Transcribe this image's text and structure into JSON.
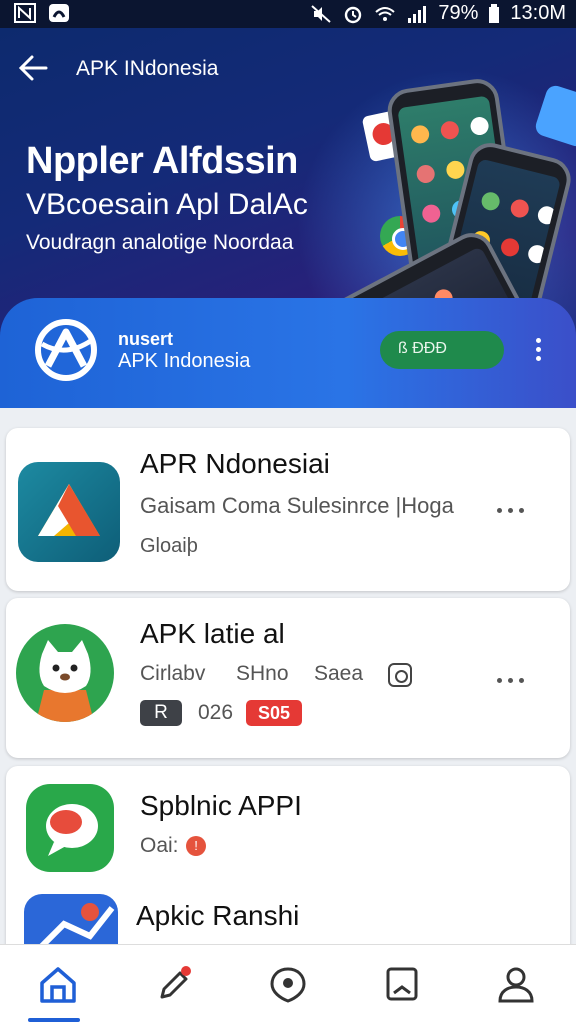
{
  "status_bar": {
    "battery": "79%",
    "time": "13:0M",
    "icons": [
      "n-logo-icon",
      "square-app-icon",
      "mute-icon",
      "alarm-icon",
      "wifi-icon",
      "signal-icon",
      "battery-icon"
    ]
  },
  "app_bar": {
    "back_icon": "arrow-left-icon",
    "title": "APK INdonesia"
  },
  "hero": {
    "headline": "Nppler Alfdssin",
    "subheadline": "VBcoesain Apl DalAc",
    "tagline": "Voudragn analotige Noordaa",
    "banner": {
      "label_small": "nusert",
      "label_name": "APK Indonesia",
      "pill_text": "ß ÐÐÐ",
      "more_icon": "vertical-dots-icon"
    }
  },
  "apps": [
    {
      "title": "APR Ndonesiai",
      "subtitle": "Gaisam Coma Sulesinrce |Hoga",
      "meta": "Gloaiþ",
      "icon": "drive-triangle-icon"
    },
    {
      "title": "APK latie al",
      "meta_parts": [
        "Cirlabv",
        "SHno",
        "Saea"
      ],
      "badge_rating": "R",
      "count": "026",
      "badge_size": "S05",
      "icon": "cat-mascot-icon"
    },
    {
      "title": "Spblnic APPI",
      "meta": "Oai:",
      "icon": "chat-bubble-icon"
    },
    {
      "title": "Apkic Ranshi",
      "icon": "ranshi-graph-icon"
    }
  ],
  "bottom_nav": {
    "items": [
      "home-icon",
      "edit-pen-icon",
      "location-chat-icon",
      "bookmark-icon",
      "profile-icon"
    ],
    "active": 0,
    "accent": "#1f5fd6"
  },
  "colors": {
    "hero_bg": "#142a78",
    "banner_blue": "#2a74e6",
    "accent_green": "#1f8a4c",
    "badge_red": "#e53935"
  }
}
